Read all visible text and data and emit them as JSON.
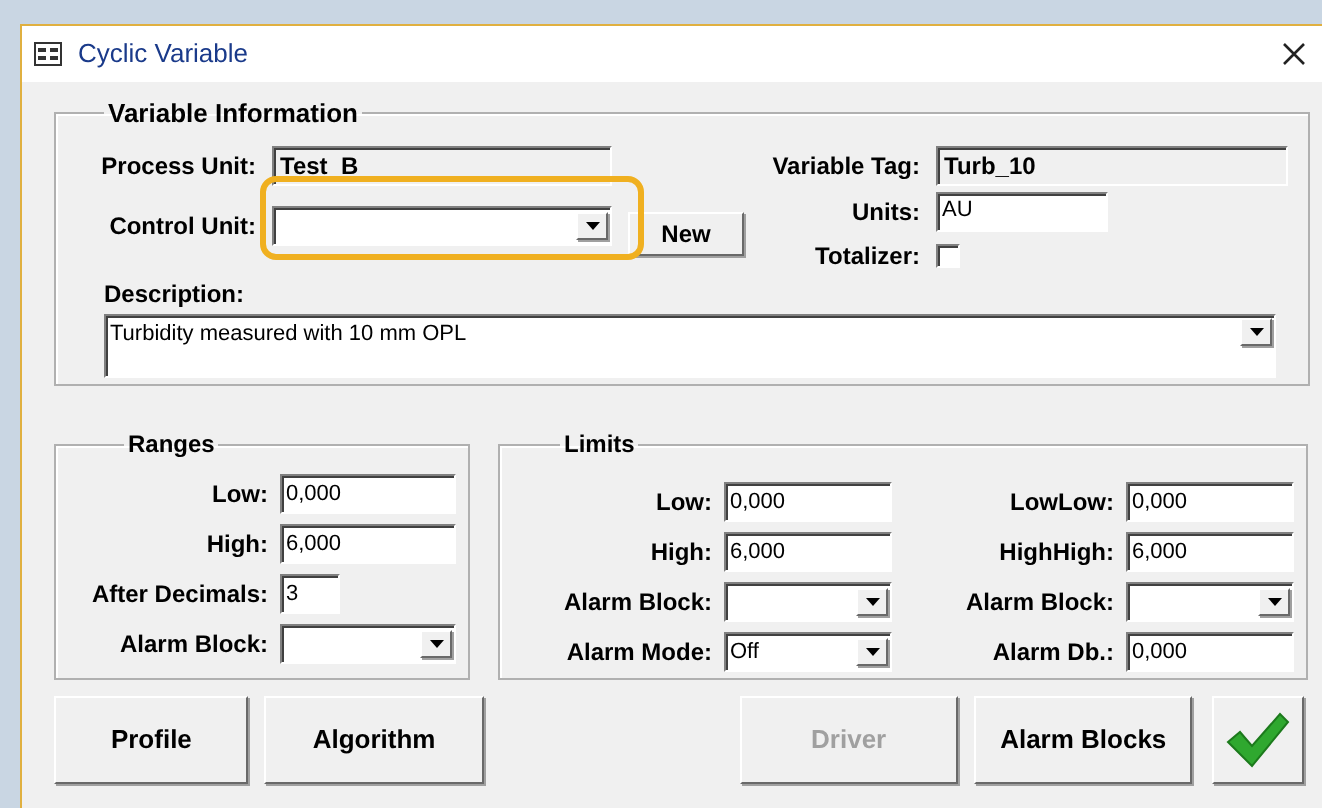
{
  "window": {
    "title": "Cyclic Variable"
  },
  "variable_information": {
    "title": "Variable Information",
    "process_unit": {
      "label": "Process Unit:",
      "value": "Test_B"
    },
    "control_unit": {
      "label": "Control Unit:"
    },
    "new_button": "New",
    "variable_tag": {
      "label": "Variable Tag:",
      "value": "Turb_10"
    },
    "units": {
      "label": "Units:",
      "value": "AU"
    },
    "totalizer": {
      "label": "Totalizer:",
      "checked": false
    },
    "description": {
      "label": "Description:",
      "value": "Turbidity measured with 10 mm OPL"
    }
  },
  "ranges": {
    "title": "Ranges",
    "fields": [
      {
        "kind": "text",
        "label": "Low:",
        "value": "0,000"
      },
      {
        "kind": "text",
        "label": "High:",
        "value": "6,000"
      },
      {
        "kind": "short",
        "label": "After Decimals:",
        "value": "3"
      },
      {
        "kind": "dropdown",
        "label": "Alarm Block:"
      }
    ]
  },
  "limits": {
    "title": "Limits",
    "fields": [
      {
        "kind": "text",
        "label": "Low:",
        "value": "0,000"
      },
      {
        "kind": "text",
        "label": "LowLow:",
        "value": "0,000"
      },
      {
        "kind": "text",
        "label": "High:",
        "value": "6,000"
      },
      {
        "kind": "text",
        "label": "HighHigh:",
        "value": "6,000"
      },
      {
        "kind": "dropdown",
        "label": "Alarm Block:"
      },
      {
        "kind": "dropdown",
        "label": "Alarm Block:"
      },
      {
        "kind": "dropdown",
        "label": "Alarm Mode:",
        "value": "Off"
      },
      {
        "kind": "text",
        "label": "Alarm Db.:",
        "value": "0,000"
      }
    ]
  },
  "buttons": [
    {
      "label": "Profile",
      "disabled": false
    },
    {
      "label": "Algorithm",
      "disabled": false
    },
    {
      "label": "Driver",
      "disabled": true
    },
    {
      "label": "Alarm Blocks",
      "disabled": false
    }
  ]
}
